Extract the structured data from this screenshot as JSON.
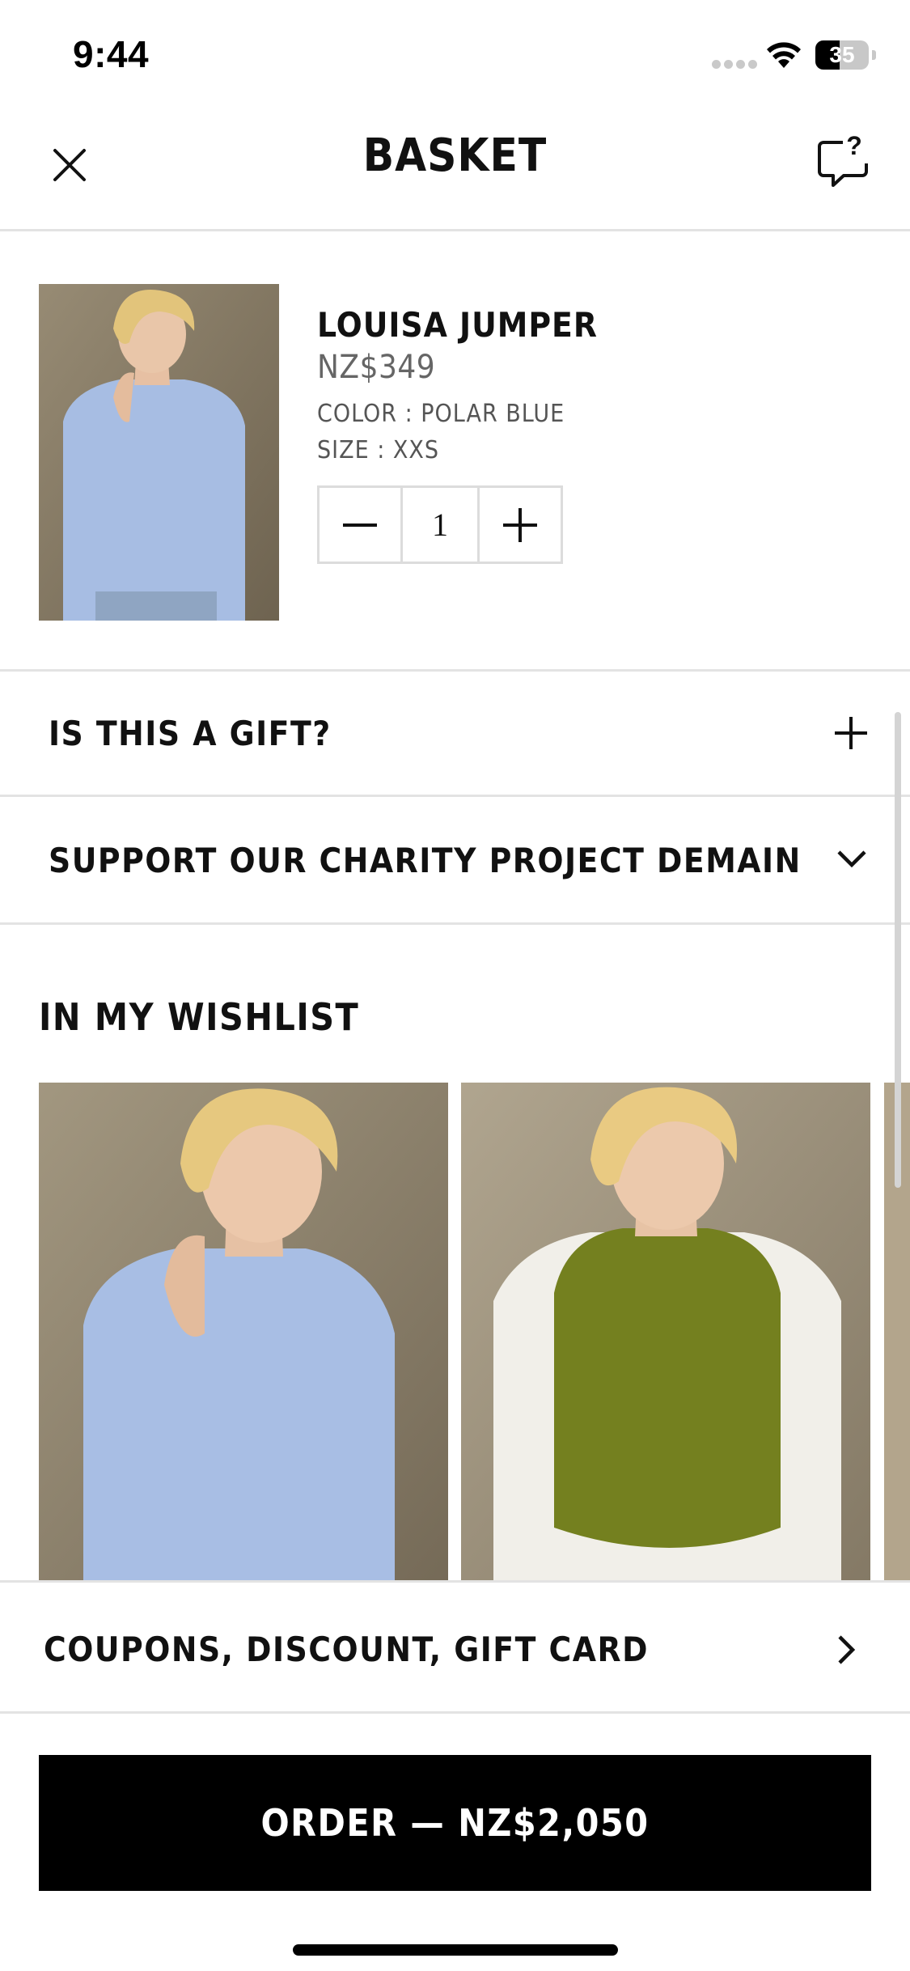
{
  "status_bar": {
    "time": "9:44",
    "battery": "35"
  },
  "header": {
    "title": "BASKET"
  },
  "basket_item": {
    "name": "LOUISA JUMPER",
    "price": "NZ$349",
    "color": "COLOR : POLAR BLUE",
    "size": "SIZE : XXS",
    "quantity": "1"
  },
  "rows": {
    "gift": "IS THIS A GIFT?",
    "charity": "SUPPORT OUR CHARITY PROJECT DEMAIN"
  },
  "wishlist": {
    "title": "IN MY WISHLIST"
  },
  "coupons": {
    "label": "COUPONS, DISCOUNT, GIFT CARD"
  },
  "order_button": {
    "label": "ORDER — NZ$2,050"
  },
  "icons": {
    "close": "close-icon",
    "help": "help-chat-icon",
    "plus": "plus-icon",
    "minus": "minus-icon",
    "chevron_down": "chevron-down-icon",
    "chevron_right": "chevron-right-icon"
  },
  "colors": {
    "primary_button": "#000000",
    "divider": "#e3e3e3",
    "muted_text": "#666666"
  }
}
